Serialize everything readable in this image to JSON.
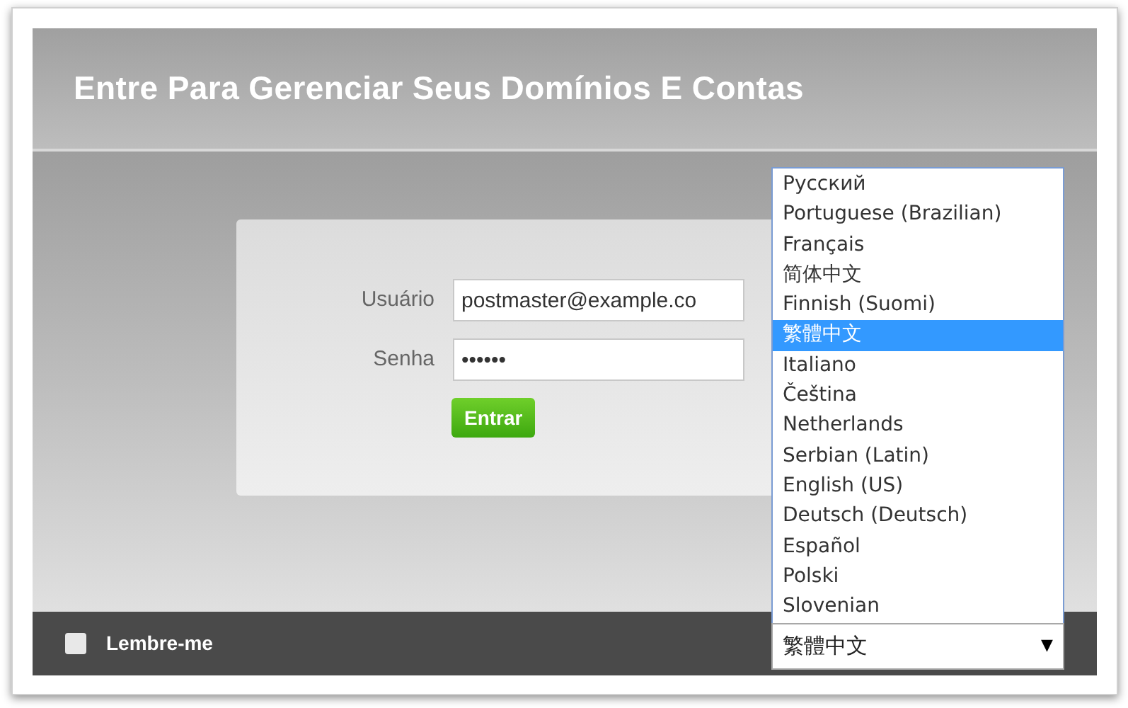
{
  "header": {
    "title": "Entre Para Gerenciar Seus Domínios E Contas"
  },
  "login": {
    "fields": [
      {
        "label": "Usuário",
        "value": "postmaster@example.co"
      },
      {
        "label": "Senha",
        "value": "••••••"
      }
    ],
    "submit": "Entrar"
  },
  "footer": {
    "remember": {
      "label": "Lembre-me",
      "checked": false
    }
  },
  "language": {
    "value": "繁體中文",
    "arrow": "▼",
    "options": [
      {
        "label": "Русский",
        "selected": false
      },
      {
        "label": "Portuguese (Brazilian)",
        "selected": false
      },
      {
        "label": "Français",
        "selected": false
      },
      {
        "label": "简体中文",
        "selected": false
      },
      {
        "label": "Finnish (Suomi)",
        "selected": false
      },
      {
        "label": "繁體中文",
        "selected": true
      },
      {
        "label": "Italiano",
        "selected": false
      },
      {
        "label": "Čeština",
        "selected": false
      },
      {
        "label": "Netherlands",
        "selected": false
      },
      {
        "label": "Serbian (Latin)",
        "selected": false
      },
      {
        "label": "English (US)",
        "selected": false
      },
      {
        "label": "Deutsch (Deutsch)",
        "selected": false
      },
      {
        "label": "Español",
        "selected": false
      },
      {
        "label": "Polski",
        "selected": false
      },
      {
        "label": "Slovenian",
        "selected": false
      }
    ]
  }
}
